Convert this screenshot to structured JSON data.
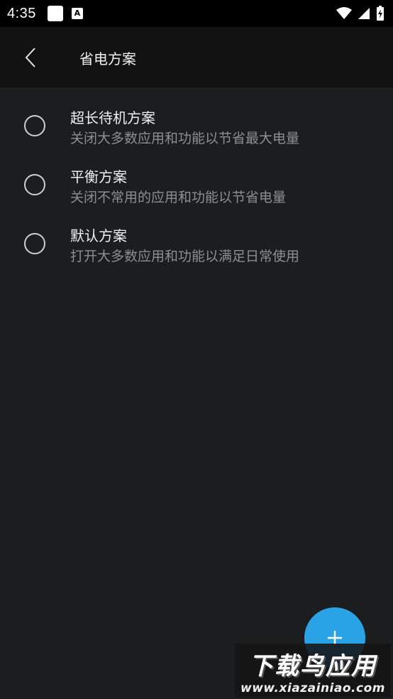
{
  "status_bar": {
    "time": "4:35",
    "notification_badge": "A"
  },
  "app_bar": {
    "title": "省电方案"
  },
  "plans": [
    {
      "title": "超长待机方案",
      "description": "关闭大多数应用和功能以节省最大电量"
    },
    {
      "title": "平衡方案",
      "description": "关闭不常用的应用和功能以节省电量"
    },
    {
      "title": "默认方案",
      "description": "打开大多数应用和功能以满足日常使用"
    }
  ],
  "fab": {
    "icon": "plus-icon",
    "color": "#29a3e6"
  },
  "watermark": {
    "main": "下载鸟应用",
    "url": "www.xiazainiao.com"
  },
  "colors": {
    "background": "#1c1d1f",
    "app_bar": "#121212",
    "status_bar": "#000000"
  }
}
